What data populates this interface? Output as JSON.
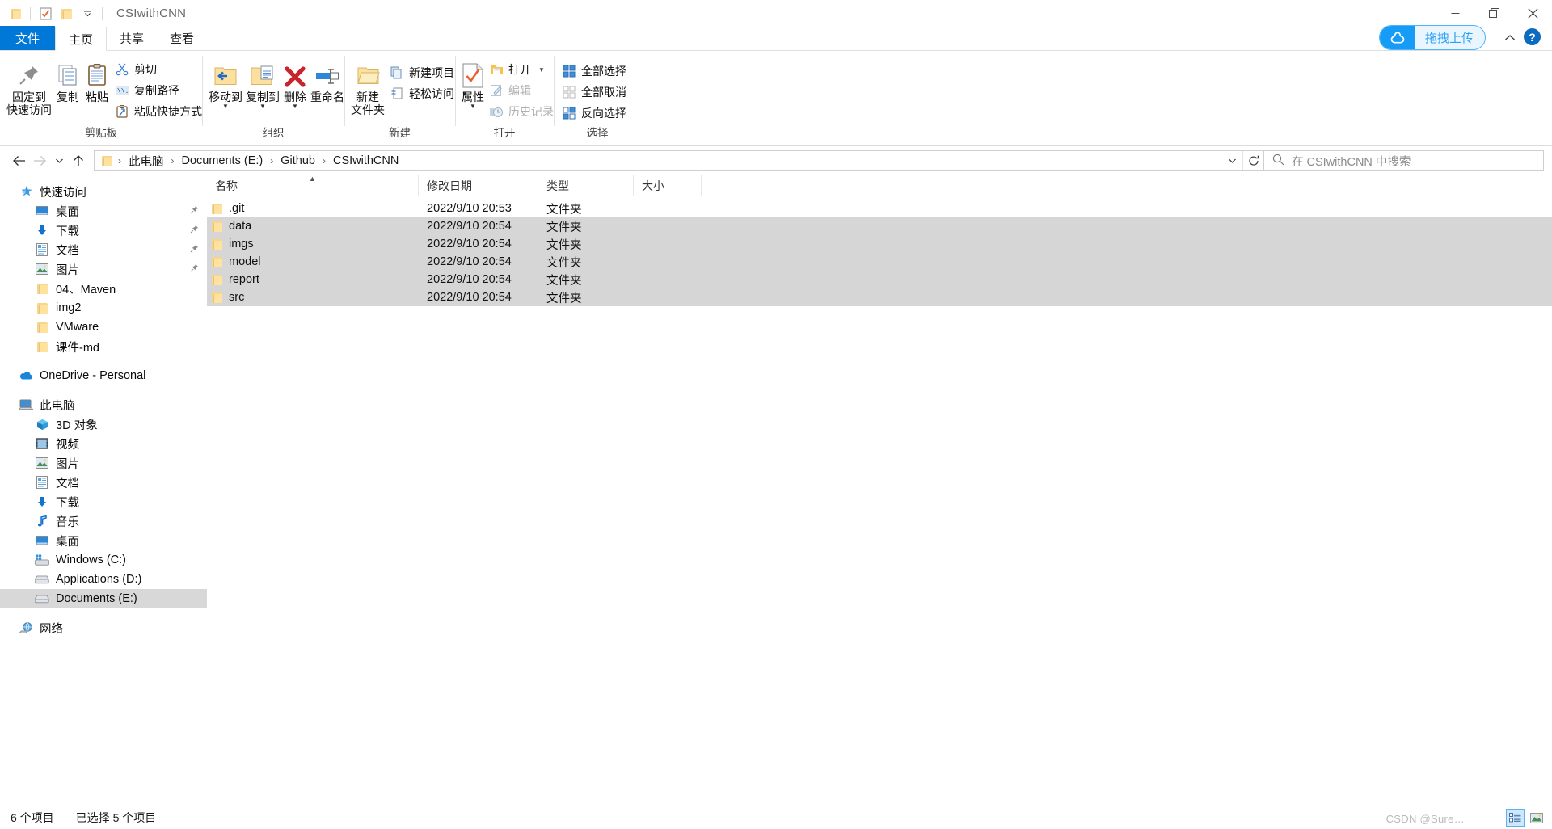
{
  "window": {
    "title": "CSIwithCNN",
    "controls": {
      "minimize": "—",
      "maximize": "❐",
      "close": "✕"
    },
    "quick_access_icons": [
      "folder-icon",
      "properties-check-icon",
      "new-folder-icon",
      "customize-caret-icon"
    ]
  },
  "ribbon": {
    "tabs": [
      {
        "id": "file",
        "label": "文件"
      },
      {
        "id": "home",
        "label": "主页"
      },
      {
        "id": "share",
        "label": "共享"
      },
      {
        "id": "view",
        "label": "查看"
      }
    ],
    "netdisk_button": {
      "label": "拖拽上传",
      "icon": "baidu-netdisk-icon",
      "accent": "#169bf7"
    },
    "collapse_icon": "chevron-up-icon",
    "help_icon": "help-question-icon",
    "groups": [
      {
        "id": "clipboard",
        "label": "剪贴板",
        "big_buttons": [
          {
            "label": "固定到\n快速访问",
            "line1": "固定到",
            "line2": "快速访问",
            "icon": "pin-icon"
          },
          {
            "label": "复制",
            "icon": "copy-icon"
          },
          {
            "label": "粘贴",
            "icon": "paste-icon"
          }
        ],
        "small_buttons": [
          {
            "label": "剪切",
            "icon": "scissors-icon"
          },
          {
            "label": "复制路径",
            "icon": "copy-path-icon"
          },
          {
            "label": "粘贴快捷方式",
            "icon": "paste-shortcut-icon"
          }
        ]
      },
      {
        "id": "organize",
        "label": "组织",
        "big_buttons": [
          {
            "label": "移动到",
            "icon": "move-to-icon",
            "has_dropdown": true
          },
          {
            "label": "复制到",
            "icon": "copy-to-icon",
            "has_dropdown": true
          },
          {
            "label": "删除",
            "icon": "delete-x-icon",
            "has_dropdown": true
          },
          {
            "label": "重命名",
            "icon": "rename-icon"
          }
        ]
      },
      {
        "id": "new",
        "label": "新建",
        "big_buttons": [
          {
            "line1": "新建",
            "line2": "文件夹",
            "label": "新建文件夹",
            "icon": "new-folder-icon"
          }
        ],
        "small_buttons": [
          {
            "label": "新建项目",
            "icon": "new-item-icon",
            "has_dropdown": true
          },
          {
            "label": "轻松访问",
            "icon": "easy-access-icon",
            "has_dropdown": true
          }
        ]
      },
      {
        "id": "open",
        "label": "打开",
        "big_buttons": [
          {
            "label": "属性",
            "icon": "properties-check-icon",
            "has_dropdown": true
          }
        ],
        "small_buttons": [
          {
            "label": "打开",
            "icon": "open-folder-icon",
            "has_dropdown": true
          },
          {
            "label": "编辑",
            "icon": "edit-pencil-icon",
            "disabled": true
          },
          {
            "label": "历史记录",
            "icon": "history-clock-icon",
            "disabled": true
          }
        ]
      },
      {
        "id": "select",
        "label": "选择",
        "small_buttons": [
          {
            "label": "全部选择",
            "icon": "select-all-icon"
          },
          {
            "label": "全部取消",
            "icon": "select-none-icon"
          },
          {
            "label": "反向选择",
            "icon": "invert-selection-icon"
          }
        ]
      }
    ]
  },
  "address_bar": {
    "back_icon": "arrow-left-icon",
    "forward_icon": "arrow-right-icon",
    "recent_icon": "chevron-down-icon",
    "up_icon": "arrow-up-icon",
    "refresh_icon": "refresh-icon",
    "dropdown_icon": "chevron-down-icon",
    "breadcrumbs": [
      "此电脑",
      "Documents (E:)",
      "Github",
      "CSIwithCNN"
    ],
    "separator": "›"
  },
  "search": {
    "placeholder": "在 CSIwithCNN 中搜索",
    "icon": "search-icon"
  },
  "sidebar": {
    "groups": [
      {
        "root": {
          "label": "快速访问",
          "icon": "quick-access-star-icon"
        },
        "items": [
          {
            "label": "桌面",
            "icon": "desktop-icon",
            "pinned": true
          },
          {
            "label": "下载",
            "icon": "downloads-arrow-icon",
            "pinned": true
          },
          {
            "label": "文档",
            "icon": "documents-icon",
            "pinned": true
          },
          {
            "label": "图片",
            "icon": "pictures-icon",
            "pinned": true
          },
          {
            "label": "04、Maven",
            "icon": "folder-icon",
            "pinned": false
          },
          {
            "label": "img2",
            "icon": "folder-icon",
            "pinned": false
          },
          {
            "label": "VMware",
            "icon": "folder-icon",
            "pinned": false
          },
          {
            "label": "课件-md",
            "icon": "folder-icon",
            "pinned": false
          }
        ]
      },
      {
        "root": {
          "label": "OneDrive - Personal",
          "icon": "onedrive-cloud-icon"
        },
        "items": []
      },
      {
        "root": {
          "label": "此电脑",
          "icon": "this-pc-icon"
        },
        "items": [
          {
            "label": "3D 对象",
            "icon": "3d-objects-icon"
          },
          {
            "label": "视频",
            "icon": "videos-icon"
          },
          {
            "label": "图片",
            "icon": "pictures-icon"
          },
          {
            "label": "文档",
            "icon": "documents-icon"
          },
          {
            "label": "下载",
            "icon": "downloads-arrow-icon"
          },
          {
            "label": "音乐",
            "icon": "music-note-icon"
          },
          {
            "label": "桌面",
            "icon": "desktop-icon"
          },
          {
            "label": "Windows (C:)",
            "icon": "windows-drive-icon"
          },
          {
            "label": "Applications (D:)",
            "icon": "drive-icon"
          },
          {
            "label": "Documents (E:)",
            "icon": "drive-icon",
            "selected": true
          }
        ]
      },
      {
        "root": {
          "label": "网络",
          "icon": "network-icon"
        },
        "items": []
      }
    ]
  },
  "file_list": {
    "columns": [
      {
        "key": "name",
        "label": "名称",
        "sorted": "asc"
      },
      {
        "key": "date",
        "label": "修改日期"
      },
      {
        "key": "type",
        "label": "类型"
      },
      {
        "key": "size",
        "label": "大小"
      }
    ],
    "rows": [
      {
        "name": ".git",
        "date": "2022/9/10 20:53",
        "type": "文件夹",
        "size": "",
        "icon": "folder-icon",
        "selected": false
      },
      {
        "name": "data",
        "date": "2022/9/10 20:54",
        "type": "文件夹",
        "size": "",
        "icon": "folder-icon",
        "selected": true
      },
      {
        "name": "imgs",
        "date": "2022/9/10 20:54",
        "type": "文件夹",
        "size": "",
        "icon": "folder-icon",
        "selected": true
      },
      {
        "name": "model",
        "date": "2022/9/10 20:54",
        "type": "文件夹",
        "size": "",
        "icon": "folder-icon",
        "selected": true
      },
      {
        "name": "report",
        "date": "2022/9/10 20:54",
        "type": "文件夹",
        "size": "",
        "icon": "folder-icon",
        "selected": true
      },
      {
        "name": "src",
        "date": "2022/9/10 20:54",
        "type": "文件夹",
        "size": "",
        "icon": "folder-icon",
        "selected": true
      }
    ]
  },
  "status_bar": {
    "item_count": "6 个项目",
    "selection": "已选择 5 个项目",
    "view_buttons": [
      {
        "name": "details-view-icon",
        "active": true
      },
      {
        "name": "large-icons-view-icon",
        "active": false
      }
    ]
  },
  "watermark": "CSDN @Sure…"
}
